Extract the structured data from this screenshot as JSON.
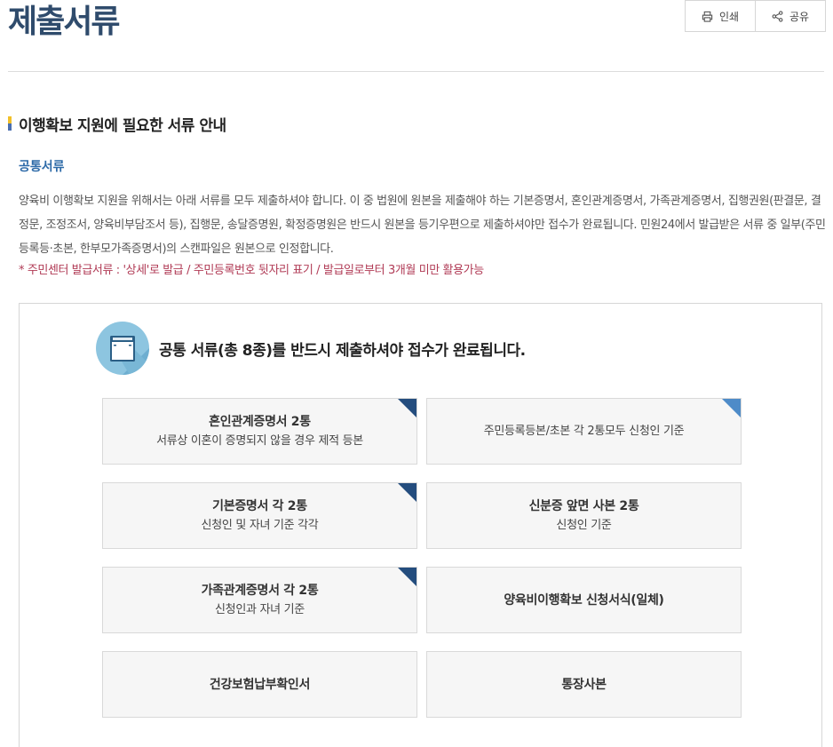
{
  "header": {
    "title": "제출서류"
  },
  "toolbar": {
    "print_label": "인쇄",
    "share_label": "공유"
  },
  "section": {
    "title": "이행확보 지원에 필요한 서류 안내",
    "subtitle": "공통서류",
    "description": "양육비 이행확보 지원을 위해서는 아래 서류를 모두 제출하셔야 합니다. 이 중 법원에 원본을 제출해야 하는 기본증명서, 혼인관계증명서, 가족관계증명서, 집행권원(판결문, 결정문, 조정조서, 양육비부담조서 등), 집행문, 송달증명원, 확정증명원은 반드시 원본을 등기우편으로 제출하셔야만 접수가 완료됩니다. 민원24에서 발급받은 서류 중 일부(주민등록등·초본, 한부모가족증명서)의 스캔파일은 원본으로 인정합니다.",
    "note": "* 주민센터 발급서류 : '상세'로 발급 / 주민등록번호 뒷자리 표기 / 발급일로부터 3개월 미만 활용가능"
  },
  "docs_box": {
    "heading": "공통 서류(총 8종)를 반드시 제출하셔야 접수가 완료됩니다.",
    "icon": "document-tray-icon",
    "cards": [
      {
        "title": "혼인관계증명서 2통",
        "detail": "서류상 이혼이 증명되지 않을 경우 제적 등본",
        "corner": "dark"
      },
      {
        "title": "",
        "detail": "주민등록등본/초본 각 2통모두 신청인 기준",
        "corner": "light"
      },
      {
        "title": "기본증명서 각 2통",
        "detail": "신청인 및 자녀 기준 각각",
        "corner": "dark"
      },
      {
        "title": "신분증 앞면 사본 2통",
        "detail": "신청인 기준",
        "corner": "none"
      },
      {
        "title": "가족관계증명서 각 2통",
        "detail": "신청인과 자녀 기준",
        "corner": "dark"
      },
      {
        "title": "양육비이행확보 신청서식(일체)",
        "detail": "",
        "corner": "none"
      },
      {
        "title": "건강보험납부확인서",
        "detail": "",
        "corner": "none"
      },
      {
        "title": "통장사본",
        "detail": "",
        "corner": "none"
      }
    ]
  },
  "colors": {
    "title": "#2f4b6c",
    "subtitle": "#2d6aa8",
    "note": "#b03a55",
    "corner_dark": "#244d7e",
    "corner_light": "#4e8bc8"
  }
}
